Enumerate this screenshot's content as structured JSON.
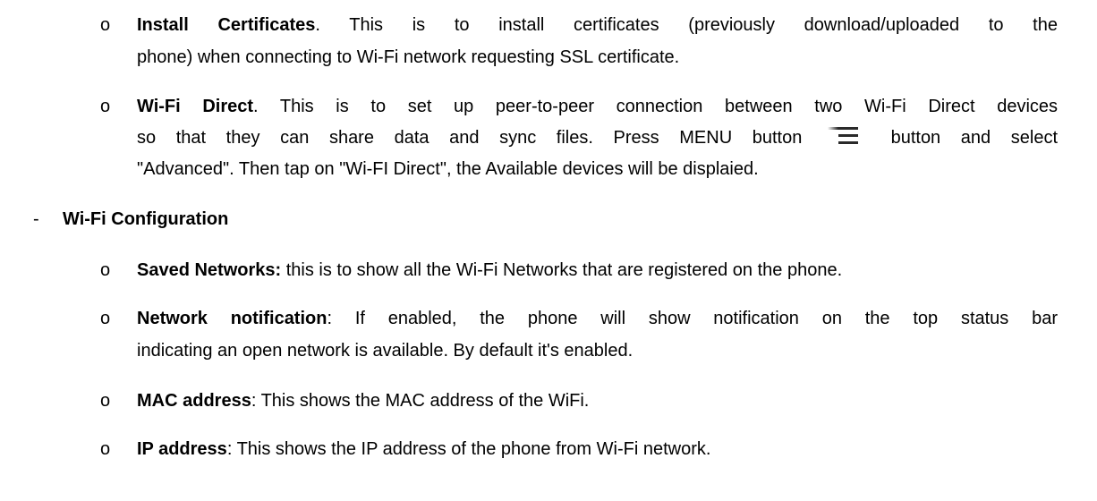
{
  "bullet_char": "o",
  "dash_char": "-",
  "items": {
    "install_certificates": {
      "title": "Install Certificates",
      "text_line1": ". This is to install certificates (previously download/uploaded to the",
      "text_line2": "phone) when connecting to Wi-Fi network requesting SSL certificate."
    },
    "wifi_direct": {
      "title": "Wi-Fi Direct",
      "text_line1": ". This is to set up peer-to-peer connection between two Wi-Fi Direct devices",
      "text_line2a": "so that they can share data and sync files. Press MENU button",
      "text_line2b": "button and select",
      "text_line3": "\"Advanced\". Then tap on \"Wi-FI Direct\", the Available devices will be displaied."
    }
  },
  "section": {
    "title": "Wi-Fi Configuration",
    "items": {
      "saved_networks": {
        "title": "Saved Networks:",
        "text": " this is to show all the Wi-Fi Networks that are registered on the phone."
      },
      "network_notification": {
        "title": "Network notification",
        "text_line1": ": If enabled, the phone will show notification on the top status bar",
        "text_line2": "indicating an open network is available. By default it's enabled."
      },
      "mac_address": {
        "title": "MAC address",
        "text": ": This shows the MAC address of the WiFi."
      },
      "ip_address": {
        "title": "IP address",
        "text": ": This shows the IP address of the phone from Wi-Fi network."
      }
    }
  },
  "icons": {
    "menu": "menu-icon"
  }
}
